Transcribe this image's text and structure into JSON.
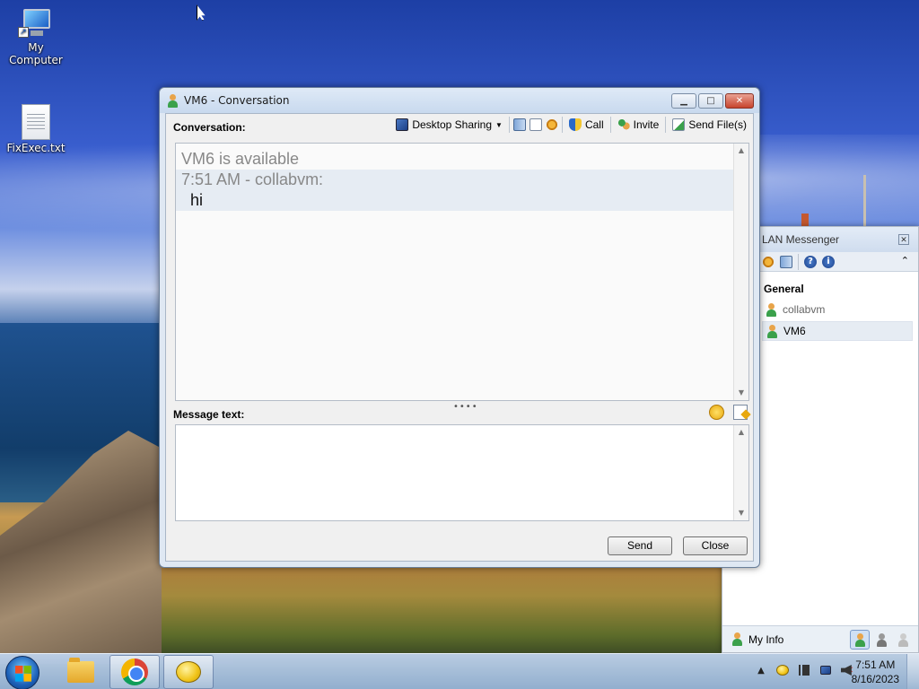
{
  "desktop": {
    "icons": [
      {
        "label": "My Computer",
        "icon": "computer-icon"
      },
      {
        "label": "FixExec.txt",
        "icon": "text-file-icon"
      }
    ]
  },
  "conversation_window": {
    "title": "VM6 - Conversation",
    "conversation_label": "Conversation:",
    "toolbar": {
      "desktop_sharing": "Desktop Sharing",
      "call": "Call",
      "invite": "Invite",
      "send_files": "Send File(s)"
    },
    "chat": {
      "status_line": "VM6 is available",
      "header_line": "7:51 AM - collabvm:",
      "message": "hi"
    },
    "message_label": "Message text:",
    "message_placeholder": "",
    "send_label": "Send",
    "close_label": "Close",
    "window_buttons": {
      "minimize": "▁",
      "maximize": "□",
      "close": "✕"
    }
  },
  "lan_messenger": {
    "title": "LAN Messenger",
    "group": "General",
    "contacts": [
      {
        "name": "collabvm",
        "status": "online"
      },
      {
        "name": "VM6",
        "status": "online",
        "selected": true
      }
    ],
    "my_info_label": "My Info"
  },
  "taskbar": {
    "apps": [
      "windows-explorer",
      "google-chrome",
      "lan-messenger"
    ],
    "clock_time": "7:51 AM",
    "clock_date": "8/16/2023"
  },
  "colors": {
    "titlebar": "#c8d9ee",
    "client_bg": "#f0f0f0",
    "online_status": "#3ba14b",
    "close_button": "#c7442d"
  }
}
